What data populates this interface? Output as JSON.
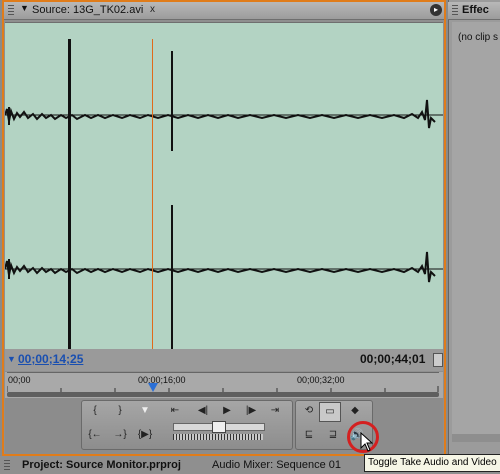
{
  "source_panel": {
    "tab_label": "Source: 13G_TK02.avi",
    "close_label": "x",
    "current_timecode": "00;00;14;25",
    "duration_timecode": "00;00;44;01",
    "ruler_ticks": [
      "00;00",
      "00;00;16;00",
      "00;00;32;00"
    ]
  },
  "effects_panel": {
    "tab_label": "Effec",
    "body_text": "(no clip s"
  },
  "bottom_tabs": {
    "project_tab": "Project: Source Monitor.prproj",
    "mixer_tab": "Audio Mixer: Sequence 01"
  },
  "tooltip": {
    "text": "Toggle Take Audio and Video"
  },
  "controls": {
    "mark_in": "{",
    "mark_out": "}",
    "set_marker": "▼",
    "goto_in": "{←",
    "goto_out": "→}",
    "play_in_out": "{▶}",
    "step_back": "◀|",
    "play": "▶",
    "step_forward": "|▶",
    "shuttle_in": "⇤",
    "shuttle_out": "⇥",
    "loop": "⟲",
    "safe_margins": "▭",
    "output": "◆",
    "insert": "⊑",
    "overlay": "⊒",
    "take_audio_video": "🔊"
  },
  "colors": {
    "waveform_bg": "#b3d3c3",
    "active_border": "#e07c1a",
    "timecode_blue": "#1a4fb0",
    "highlight_red": "#d42020"
  }
}
